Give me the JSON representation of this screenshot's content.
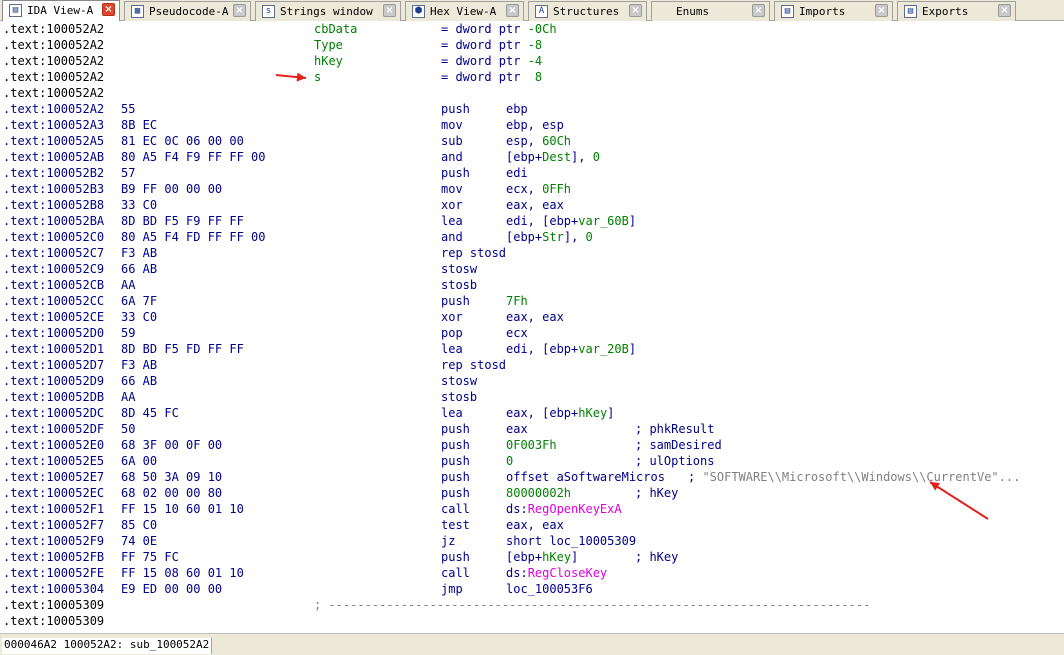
{
  "tabs": [
    {
      "label": "IDA View-A",
      "icon": "ida-view-icon",
      "active": true
    },
    {
      "label": "Pseudocode-A",
      "icon": "pseudocode-icon",
      "active": false
    },
    {
      "label": "Strings window",
      "icon": "strings-icon",
      "active": false
    },
    {
      "label": "Hex View-A",
      "icon": "hex-view-icon",
      "active": false
    },
    {
      "label": "Structures",
      "icon": "structures-icon",
      "active": false
    },
    {
      "label": "Enums",
      "icon": "enums-icon",
      "active": false
    },
    {
      "label": "Imports",
      "icon": "imports-icon",
      "active": false
    },
    {
      "label": "Exports",
      "icon": "exports-icon",
      "active": false
    }
  ],
  "stack_vars": [
    {
      "addr": ".text:100052A2",
      "name": "cbData",
      "def": "= dword ptr -0Ch"
    },
    {
      "addr": ".text:100052A2",
      "name": "Type",
      "def": "= dword ptr -8"
    },
    {
      "addr": ".text:100052A2",
      "name": "hKey",
      "def": "= dword ptr -4"
    },
    {
      "addr": ".text:100052A2",
      "name": "s",
      "def": "= dword ptr  8"
    }
  ],
  "blank_addr": ".text:100052A2",
  "instructions": [
    {
      "addr": ".text:100052A2",
      "bytes": "55",
      "mnemonic": "push",
      "operands": "ebp",
      "comment": ""
    },
    {
      "addr": ".text:100052A3",
      "bytes": "8B EC",
      "mnemonic": "mov",
      "operands": "ebp, esp",
      "comment": ""
    },
    {
      "addr": ".text:100052A5",
      "bytes": "81 EC 0C 06 00 00",
      "mnemonic": "sub",
      "operands": "esp, 60Ch",
      "comment": ""
    },
    {
      "addr": ".text:100052AB",
      "bytes": "80 A5 F4 F9 FF FF 00",
      "mnemonic": "and",
      "operands": "[ebp+Dest], 0",
      "comment": ""
    },
    {
      "addr": ".text:100052B2",
      "bytes": "57",
      "mnemonic": "push",
      "operands": "edi",
      "comment": ""
    },
    {
      "addr": ".text:100052B3",
      "bytes": "B9 FF 00 00 00",
      "mnemonic": "mov",
      "operands": "ecx, 0FFh",
      "comment": ""
    },
    {
      "addr": ".text:100052B8",
      "bytes": "33 C0",
      "mnemonic": "xor",
      "operands": "eax, eax",
      "comment": ""
    },
    {
      "addr": ".text:100052BA",
      "bytes": "8D BD F5 F9 FF FF",
      "mnemonic": "lea",
      "operands": "edi, [ebp+var_60B]",
      "comment": ""
    },
    {
      "addr": ".text:100052C0",
      "bytes": "80 A5 F4 FD FF FF 00",
      "mnemonic": "and",
      "operands": "[ebp+Str], 0",
      "comment": ""
    },
    {
      "addr": ".text:100052C7",
      "bytes": "F3 AB",
      "mnemonic": "rep stosd",
      "operands": "",
      "comment": ""
    },
    {
      "addr": ".text:100052C9",
      "bytes": "66 AB",
      "mnemonic": "stosw",
      "operands": "",
      "comment": ""
    },
    {
      "addr": ".text:100052CB",
      "bytes": "AA",
      "mnemonic": "stosb",
      "operands": "",
      "comment": ""
    },
    {
      "addr": ".text:100052CC",
      "bytes": "6A 7F",
      "mnemonic": "push",
      "operands": "7Fh",
      "comment": ""
    },
    {
      "addr": ".text:100052CE",
      "bytes": "33 C0",
      "mnemonic": "xor",
      "operands": "eax, eax",
      "comment": ""
    },
    {
      "addr": ".text:100052D0",
      "bytes": "59",
      "mnemonic": "pop",
      "operands": "ecx",
      "comment": ""
    },
    {
      "addr": ".text:100052D1",
      "bytes": "8D BD F5 FD FF FF",
      "mnemonic": "lea",
      "operands": "edi, [ebp+var_20B]",
      "comment": ""
    },
    {
      "addr": ".text:100052D7",
      "bytes": "F3 AB",
      "mnemonic": "rep stosd",
      "operands": "",
      "comment": ""
    },
    {
      "addr": ".text:100052D9",
      "bytes": "66 AB",
      "mnemonic": "stosw",
      "operands": "",
      "comment": ""
    },
    {
      "addr": ".text:100052DB",
      "bytes": "AA",
      "mnemonic": "stosb",
      "operands": "",
      "comment": ""
    },
    {
      "addr": ".text:100052DC",
      "bytes": "8D 45 FC",
      "mnemonic": "lea",
      "operands": "eax, [ebp+hKey]",
      "comment": ""
    },
    {
      "addr": ".text:100052DF",
      "bytes": "50",
      "mnemonic": "push",
      "operands": "eax",
      "comment": "; phkResult"
    },
    {
      "addr": ".text:100052E0",
      "bytes": "68 3F 00 0F 00",
      "mnemonic": "push",
      "operands": "0F003Fh",
      "comment": "; samDesired"
    },
    {
      "addr": ".text:100052E5",
      "bytes": "6A 00",
      "mnemonic": "push",
      "operands": "0",
      "comment": "; ulOptions"
    },
    {
      "addr": ".text:100052E7",
      "bytes": "68 50 3A 09 10",
      "mnemonic": "push",
      "operands": "offset aSoftwareMicros",
      "comment": "; \"SOFTWARE\\\\Microsoft\\\\Windows\\\\CurrentVe\"..."
    },
    {
      "addr": ".text:100052EC",
      "bytes": "68 02 00 00 80",
      "mnemonic": "push",
      "operands": "80000002h",
      "comment": "; hKey"
    },
    {
      "addr": ".text:100052F1",
      "bytes": "FF 15 10 60 01 10",
      "mnemonic": "call",
      "operands": "ds:RegOpenKeyExA",
      "comment": ""
    },
    {
      "addr": ".text:100052F7",
      "bytes": "85 C0",
      "mnemonic": "test",
      "operands": "eax, eax",
      "comment": ""
    },
    {
      "addr": ".text:100052F9",
      "bytes": "74 0E",
      "mnemonic": "jz",
      "operands": "short loc_10005309",
      "comment": ""
    },
    {
      "addr": ".text:100052FB",
      "bytes": "FF 75 FC",
      "mnemonic": "push",
      "operands": "[ebp+hKey]",
      "comment": "; hKey"
    },
    {
      "addr": ".text:100052FE",
      "bytes": "FF 15 08 60 01 10",
      "mnemonic": "call",
      "operands": "ds:RegCloseKey",
      "comment": ""
    },
    {
      "addr": ".text:10005304",
      "bytes": "E9 ED 00 00 00",
      "mnemonic": "jmp",
      "operands": "loc_100053F6",
      "comment": ""
    }
  ],
  "trailer": [
    {
      "addr": ".text:10005309",
      "text": "; ---------------------------------------------------------------------------"
    },
    {
      "addr": ".text:10005309",
      "text": ""
    }
  ],
  "status": {
    "text": "000046A2 100052A2: sub_100052A2"
  },
  "colors": {
    "highlight_arrow": "#e8201c",
    "api_name": "#e000e0",
    "variable": "#008000"
  }
}
